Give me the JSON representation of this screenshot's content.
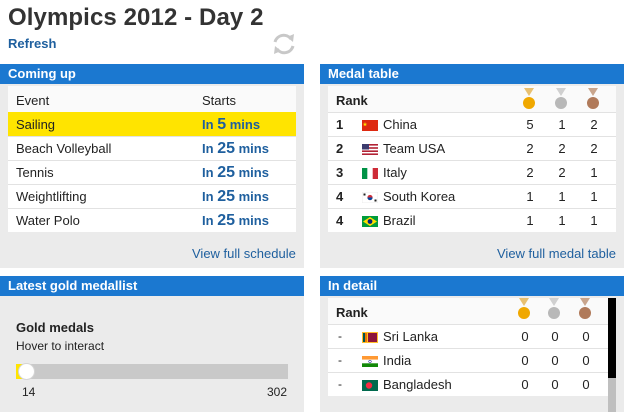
{
  "header": {
    "title": "Olympics 2012 - Day 2",
    "refresh_label": "Refresh"
  },
  "coming_up": {
    "title": "Coming up",
    "col_event": "Event",
    "col_starts": "Starts",
    "rows": [
      {
        "event": "Sailing",
        "prefix": "In",
        "num": "5",
        "unit": "mins",
        "highlight": true
      },
      {
        "event": "Beach Volleyball",
        "prefix": "In",
        "num": "25",
        "unit": "mins"
      },
      {
        "event": "Tennis",
        "prefix": "In",
        "num": "25",
        "unit": "mins"
      },
      {
        "event": "Weightlifting",
        "prefix": "In",
        "num": "25",
        "unit": "mins"
      },
      {
        "event": "Water Polo",
        "prefix": "In",
        "num": "25",
        "unit": "mins"
      }
    ],
    "link": "View full schedule"
  },
  "medal_table": {
    "title": "Medal table",
    "col_rank": "Rank",
    "rows": [
      {
        "rank": "1",
        "country": "China",
        "flag": "china-flag",
        "gold": "5",
        "silver": "1",
        "bronze": "2"
      },
      {
        "rank": "2",
        "country": "Team USA",
        "flag": "usa-flag",
        "gold": "2",
        "silver": "2",
        "bronze": "2"
      },
      {
        "rank": "3",
        "country": "Italy",
        "flag": "italy-flag",
        "gold": "2",
        "silver": "2",
        "bronze": "1"
      },
      {
        "rank": "4",
        "country": "South Korea",
        "flag": "south-korea-flag",
        "gold": "1",
        "silver": "1",
        "bronze": "1"
      },
      {
        "rank": "4",
        "country": "Brazil",
        "flag": "brazil-flag",
        "gold": "1",
        "silver": "1",
        "bronze": "1"
      }
    ],
    "link": "View full medal table"
  },
  "latest_gold": {
    "title": "Latest gold medallist",
    "label": "Gold medals",
    "hint": "Hover to interact",
    "slider_min": "14",
    "slider_max": "302",
    "slider_value_fraction": 0.0
  },
  "in_detail": {
    "title": "In detail",
    "col_rank": "Rank",
    "rows": [
      {
        "rank": "-",
        "country": "Sri Lanka",
        "flag": "sri-lanka-flag",
        "gold": "0",
        "silver": "0",
        "bronze": "0"
      },
      {
        "rank": "-",
        "country": "India",
        "flag": "india-flag",
        "gold": "0",
        "silver": "0",
        "bronze": "0"
      },
      {
        "rank": "-",
        "country": "Bangladesh",
        "flag": "bangladesh-flag",
        "gold": "0",
        "silver": "0",
        "bronze": "0"
      }
    ]
  },
  "colors": {
    "accent": "#1b78d0",
    "highlight": "#ffe400",
    "link": "#1e5f9e",
    "gold": "#f0a800",
    "silver": "#b8b8b8",
    "bronze": "#b07a5a"
  }
}
